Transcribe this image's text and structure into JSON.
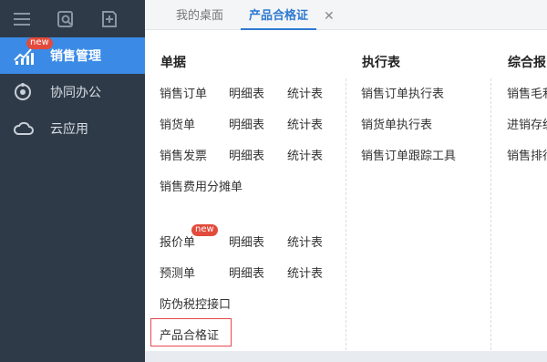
{
  "sidebar": {
    "items": [
      {
        "label": "销售管理",
        "icon": "bar-chart-icon",
        "badge": "new",
        "active": true
      },
      {
        "label": "协同办公",
        "icon": "collaboration-icon"
      },
      {
        "label": "云应用",
        "icon": "cloud-icon"
      }
    ]
  },
  "tabs": [
    {
      "label": "我的桌面"
    },
    {
      "label": "产品合格证",
      "active": true,
      "close": "✕"
    }
  ],
  "columns": {
    "doc": {
      "title": "单据",
      "rows": [
        [
          "销售订单",
          "明细表",
          "统计表"
        ],
        [
          "销货单",
          "明细表",
          "统计表"
        ],
        [
          "销售发票",
          "明细表",
          "统计表"
        ],
        [
          "销售费用分摊单"
        ],
        [
          "报价单",
          "明细表",
          "统计表"
        ],
        [
          "预测单",
          "明细表",
          "统计表"
        ],
        [
          "防伪税控接口"
        ],
        [
          "产品合格证"
        ]
      ],
      "quote_badge": "new"
    },
    "exec": {
      "title": "执行表",
      "items": [
        "销售订单执行表",
        "销货单执行表",
        "销售订单跟踪工具"
      ]
    },
    "summary": {
      "title": "综合报",
      "items": [
        "销售毛利",
        "进销存统",
        "销售排行"
      ]
    }
  },
  "colors": {
    "accent": "#3b8be6",
    "sidebar_bg": "#2f3a48",
    "badge": "#e24b3c",
    "highlight": "#e5484d"
  }
}
